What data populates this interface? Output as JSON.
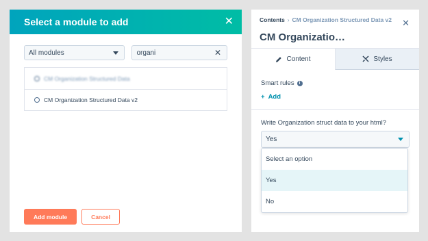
{
  "modal": {
    "title": "Select a module to add",
    "filter_select": "All modules",
    "search_value": "organi",
    "results": [
      {
        "label": "CM Organization Structured Data",
        "blurred": true
      },
      {
        "label": "CM Organization Structured Data v2",
        "blurred": false
      }
    ],
    "add_label": "Add module",
    "cancel_label": "Cancel"
  },
  "panel": {
    "breadcrumb_root": "Contents",
    "breadcrumb_sep": "›",
    "breadcrumb_current": "CM Organization Structured Data v2",
    "title": "CM Organizatio…",
    "tabs": [
      {
        "label": "Content",
        "icon": "pencil-icon",
        "active": true
      },
      {
        "label": "Styles",
        "icon": "brush-icon",
        "active": false
      }
    ],
    "smart_rules_label": "Smart rules",
    "add_label": "Add",
    "field_label": "Write Organization struct data to your html?",
    "field_value": "Yes",
    "options": [
      {
        "label": "Select an option",
        "highlighted": false
      },
      {
        "label": "Yes",
        "highlighted": true
      },
      {
        "label": "No",
        "highlighted": false
      }
    ]
  },
  "colors": {
    "header_gradient_start": "#00a4bd",
    "header_gradient_end": "#00bda5",
    "primary": "#ff7a59",
    "link": "#0091ae"
  }
}
